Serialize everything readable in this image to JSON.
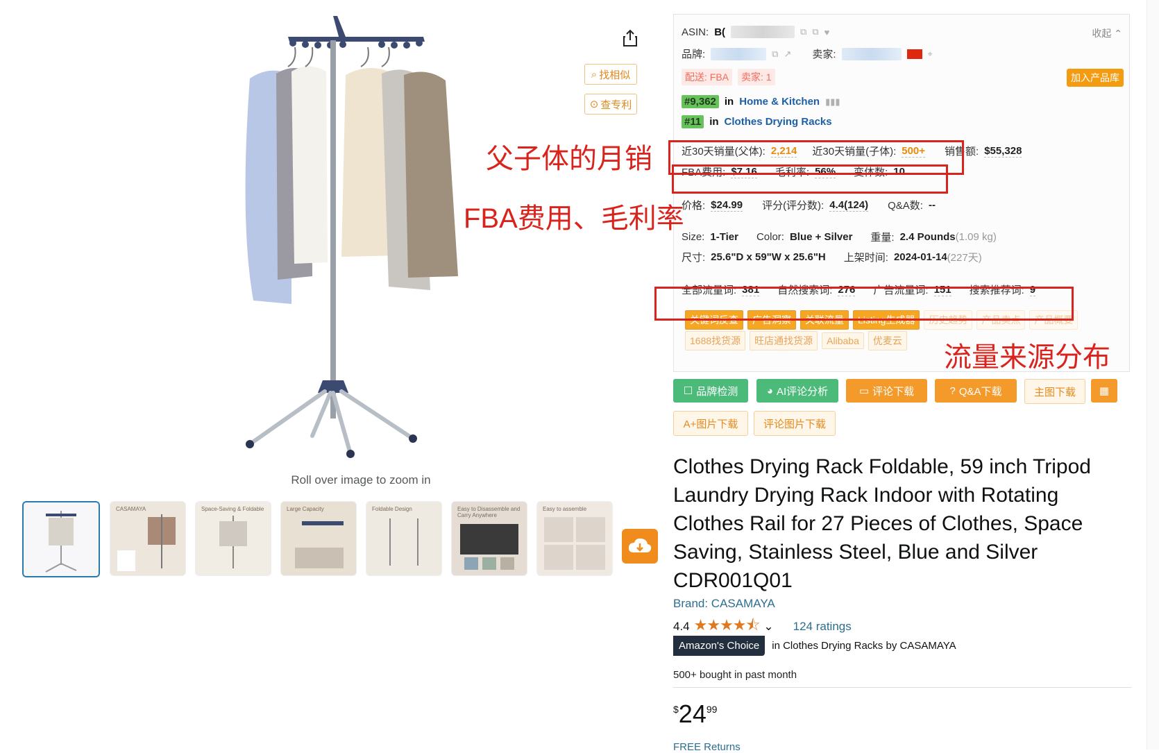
{
  "left": {
    "zoom_hint": "Roll over image to zoom in",
    "find_similar": "找相似",
    "check_patent": "查专利",
    "thumbnails": [
      {
        "caption": ""
      },
      {
        "caption": "CASAMAYA"
      },
      {
        "caption": "Space-Saving & Foldable"
      },
      {
        "caption": "Large Capacity"
      },
      {
        "caption": "Foldable Design"
      },
      {
        "caption": "Easy to Disassemble and Carry Anywhere"
      },
      {
        "caption": "Easy to assemble"
      }
    ]
  },
  "panel": {
    "asin_label": "ASIN:",
    "asin_value": "B(",
    "collapse": "收起",
    "brand_label": "品牌:",
    "seller_label": "卖家:",
    "delivery_tag": "配送: FBA",
    "seller_count_tag": "卖家: 1",
    "add_library": "加入产品库",
    "rank1_badge": "#9,362",
    "rank1_in": "in",
    "rank1_cat": "Home & Kitchen",
    "rank2_badge": "#11",
    "rank2_in": "in",
    "rank2_cat": "Clothes Drying Racks",
    "sales_parent_label": "近30天销量(父体):",
    "sales_parent_value": "2,214",
    "sales_child_label": "近30天销量(子体):",
    "sales_child_value": "500+",
    "revenue_label": "销售额:",
    "revenue_value": "$55,328",
    "fba_label": "FBA费用:",
    "fba_value": "$7.16",
    "margin_label": "毛利率:",
    "margin_value": "56%",
    "variants_label": "变体数:",
    "variants_value": "10",
    "price_label": "价格:",
    "price_value": "$24.99",
    "rating_label": "评分(评分数):",
    "rating_value": "4.4(124)",
    "qa_label": "Q&A数:",
    "qa_value": "--",
    "size_label": "Size:",
    "size_value": "1-Tier",
    "color_label": "Color:",
    "color_value": "Blue + Silver",
    "weight_label": "重量:",
    "weight_value": "2.4 Pounds",
    "weight_kg": "(1.09 kg)",
    "dims_label": "尺寸:",
    "dims_value": "25.6\"D x 59\"W x 25.6\"H",
    "listed_label": "上架时间:",
    "listed_value": "2024-01-14",
    "listed_days": "(227天)",
    "kw_all_label": "全部流量词:",
    "kw_all_value": "381",
    "kw_organic_label": "自然搜索词:",
    "kw_organic_value": "276",
    "kw_ad_label": "广告流量词:",
    "kw_ad_value": "151",
    "kw_suggest_label": "搜索推荐词:",
    "kw_suggest_value": "9",
    "tags_row1": [
      "关键词反查",
      "广告洞察",
      "关联流量",
      "Listing生成器",
      "历史趋势",
      "产品卖点",
      "产品概要"
    ],
    "tags_row2": [
      "1688找货源",
      "旺店通找货源",
      "Alibaba",
      "优麦云"
    ]
  },
  "actions": {
    "brand_check": "品牌检测",
    "ai_review": "AI评论分析",
    "review_download": "评论下载",
    "qa_download": "Q&A下载",
    "main_image_download": "主图下载",
    "aplus_download": "A+图片下载",
    "review_image_download": "评论图片下载"
  },
  "notes": {
    "note1": "父子体的月销",
    "note2": "FBA费用、毛利率",
    "note3": "流量来源分布"
  },
  "product": {
    "title": "Clothes Drying Rack Foldable, 59 inch Tripod Laundry Drying Rack Indoor with Rotating Clothes Rail for 27 Pieces of Clothes, Space Saving, Stainless Steel, Blue and Silver CDR001Q01",
    "brand": "Brand: CASAMAYA",
    "rating": "4.4",
    "ratings_count": "124 ratings",
    "choice_badge": "Amazon's Choice",
    "choice_context": "in Clothes Drying Racks by CASAMAYA",
    "bought": "500+ bought in past month",
    "price_currency": "$",
    "price_dollars": "24",
    "price_cents": "99",
    "free_returns": "FREE Returns"
  },
  "colors": {
    "accent_orange": "#f39c12",
    "annotation_red": "#d9231d",
    "rank_green": "#68c25c",
    "link_blue": "#1d5fa6"
  }
}
